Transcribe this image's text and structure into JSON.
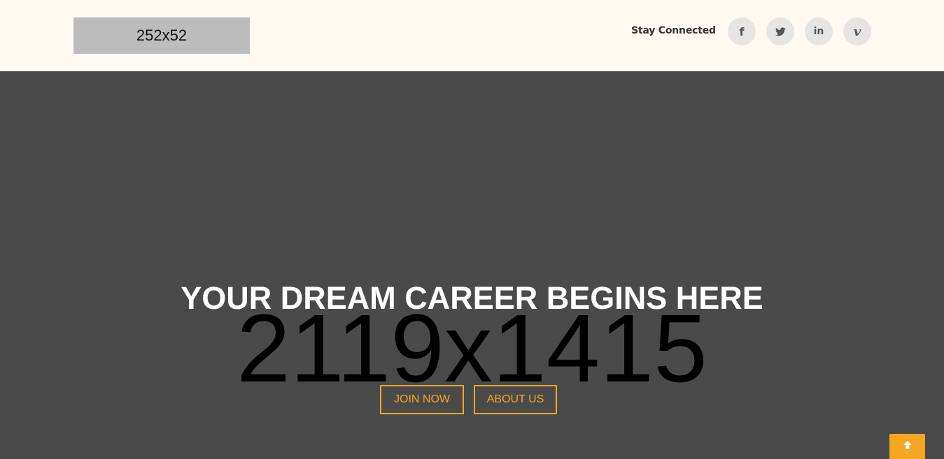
{
  "header": {
    "logo_text": "252x52",
    "social_label": "Stay Connected",
    "social_links": [
      {
        "name": "facebook",
        "icon": "facebook-icon",
        "glyph": "f"
      },
      {
        "name": "twitter",
        "icon": "twitter-icon"
      },
      {
        "name": "linkedin",
        "icon": "linkedin-icon",
        "glyph": "in"
      },
      {
        "name": "vimeo",
        "icon": "vimeo-icon",
        "glyph": "v"
      }
    ]
  },
  "hero": {
    "background_placeholder": "2119x1415",
    "title": "YOUR DREAM CAREER BEGINS HERE",
    "join_label": "JOIN NOW",
    "about_label": "ABOUT US"
  },
  "scroll_top": {
    "icon": "arrow-up-icon"
  },
  "colors": {
    "header_bg": "#fff9f2",
    "hero_bg": "#4a4a4a",
    "accent": "#f5a623",
    "icon_circle": "#e6e5e3"
  }
}
